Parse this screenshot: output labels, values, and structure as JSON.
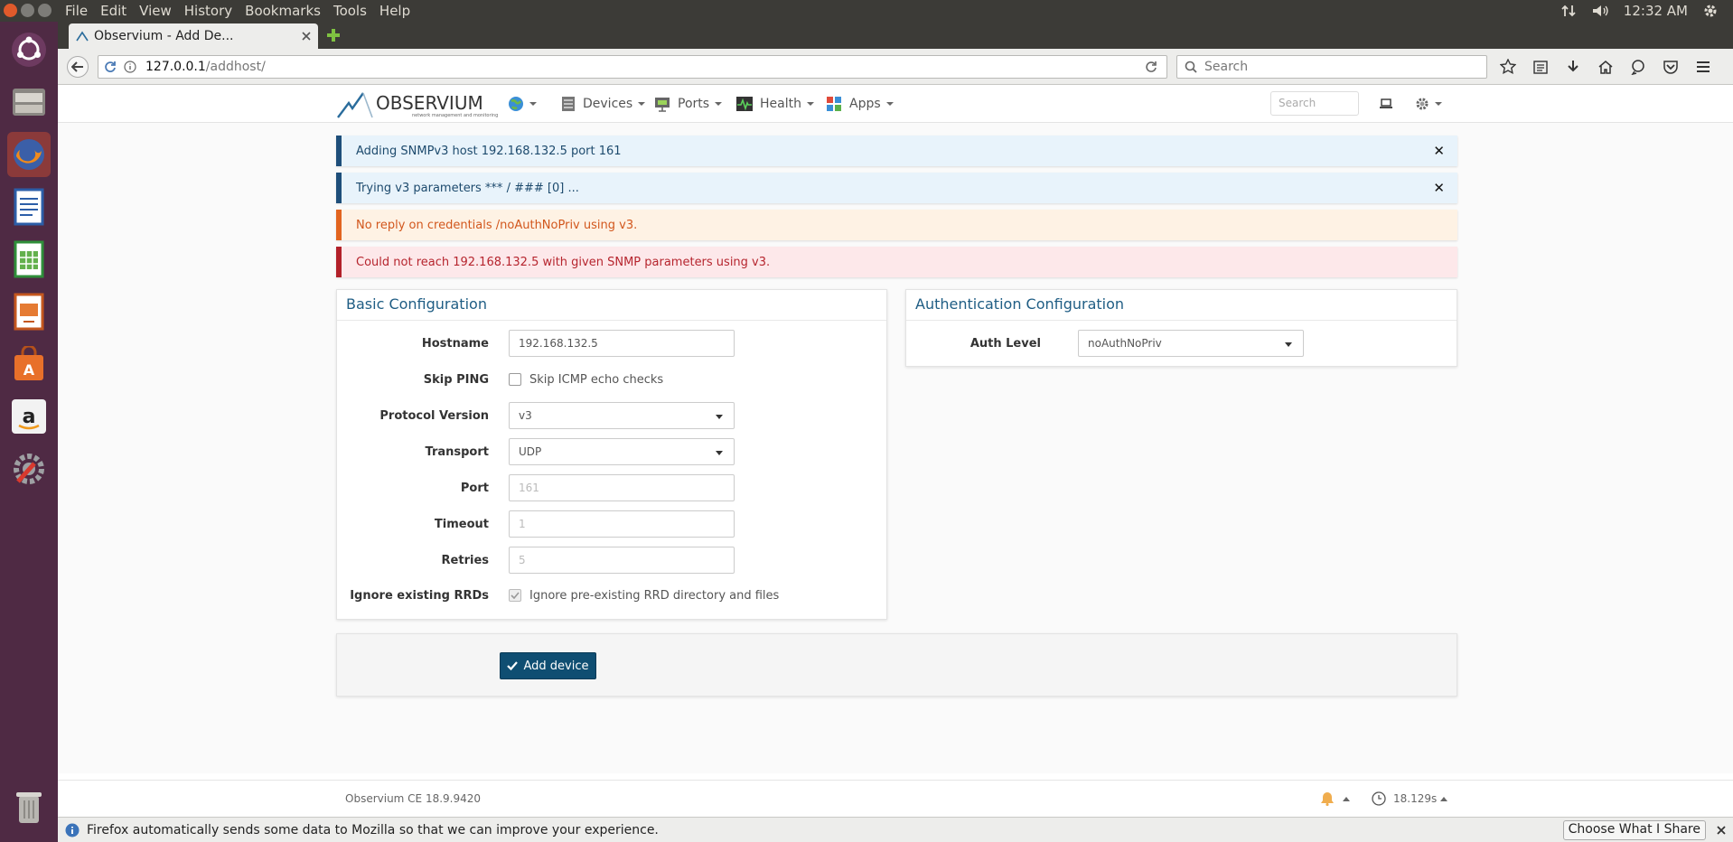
{
  "os": {
    "menus": [
      "File",
      "Edit",
      "View",
      "History",
      "Bookmarks",
      "Tools",
      "Help"
    ],
    "clock": "12:32 AM"
  },
  "browser": {
    "tab_title": "Observium - Add De...",
    "url_host": "127.0.0.1",
    "url_path": "/addhost/",
    "search_placeholder": "Search",
    "notification": "Firefox automatically sends some data to Mozilla so that we can improve your experience.",
    "notification_button": "Choose What I Share"
  },
  "app": {
    "logo_text": "OBSERVIUM",
    "logo_tagline": "network management and monitoring",
    "nav": [
      "Devices",
      "Ports",
      "Health",
      "Apps"
    ],
    "search_placeholder": "Search"
  },
  "alerts": [
    {
      "type": "info",
      "text": "Adding SNMPv3 host 192.168.132.5 port 161"
    },
    {
      "type": "info",
      "text": "Trying v3 parameters *** / ### [0] ..."
    },
    {
      "type": "warning",
      "text": "No reply on credentials /noAuthNoPriv using v3."
    },
    {
      "type": "error",
      "text": "Could not reach 192.168.132.5 with given SNMP parameters using v3."
    }
  ],
  "basic": {
    "title": "Basic Configuration",
    "hostname_label": "Hostname",
    "hostname_value": "192.168.132.5",
    "skip_ping_label": "Skip PING",
    "skip_ping_text": "Skip ICMP echo checks",
    "protocol_label": "Protocol Version",
    "protocol_value": "v3",
    "transport_label": "Transport",
    "transport_value": "UDP",
    "port_label": "Port",
    "port_placeholder": "161",
    "timeout_label": "Timeout",
    "timeout_placeholder": "1",
    "retries_label": "Retries",
    "retries_placeholder": "5",
    "ignore_label": "Ignore existing RRDs",
    "ignore_text": "Ignore pre-existing RRD directory and files"
  },
  "auth": {
    "title": "Authentication Configuration",
    "level_label": "Auth Level",
    "level_value": "noAuthNoPriv"
  },
  "actions": {
    "add_device": "Add device"
  },
  "footer": {
    "version": "Observium CE 18.9.9420",
    "timing": "18.129s"
  },
  "colors": {
    "accent": "#0f4e72",
    "launcher": "#4f2a44",
    "info_bar": "#1e4e7a",
    "warning_bar": "#e2641f",
    "error_bar": "#b22029"
  }
}
